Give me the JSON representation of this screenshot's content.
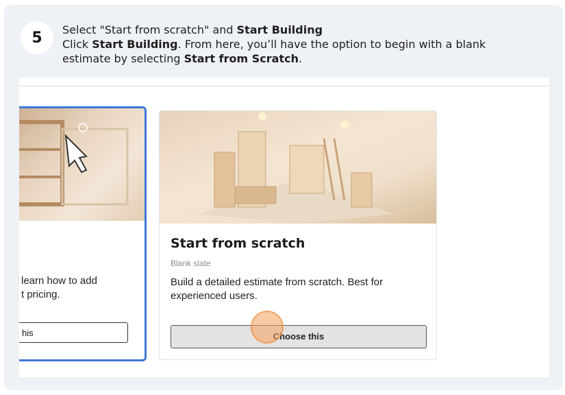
{
  "step": {
    "number": "5",
    "line1_prefix": "Select \"Start from scratch\" and ",
    "line1_bold": "Start Building",
    "line2_prefix": "Click ",
    "line2_bold1": "Start Building",
    "line2_mid": ". From here, you’ll have the option to begin with a blank estimate by selecting ",
    "line2_bold2": "Start from Scratch",
    "line2_suffix": "."
  },
  "cards": {
    "left": {
      "desc_line1": "learn how to add",
      "desc_line2": "t pricing.",
      "button_label": "his"
    },
    "right": {
      "title": "Start from scratch",
      "subtitle": "Blank slate",
      "description": "Build a detailed estimate from scratch. Best for experienced users.",
      "button_label": "Choose this"
    }
  },
  "colors": {
    "selected_border": "#3b78d8",
    "click_highlight": "#f4a05a",
    "panel_bg": "#eef1f6"
  }
}
